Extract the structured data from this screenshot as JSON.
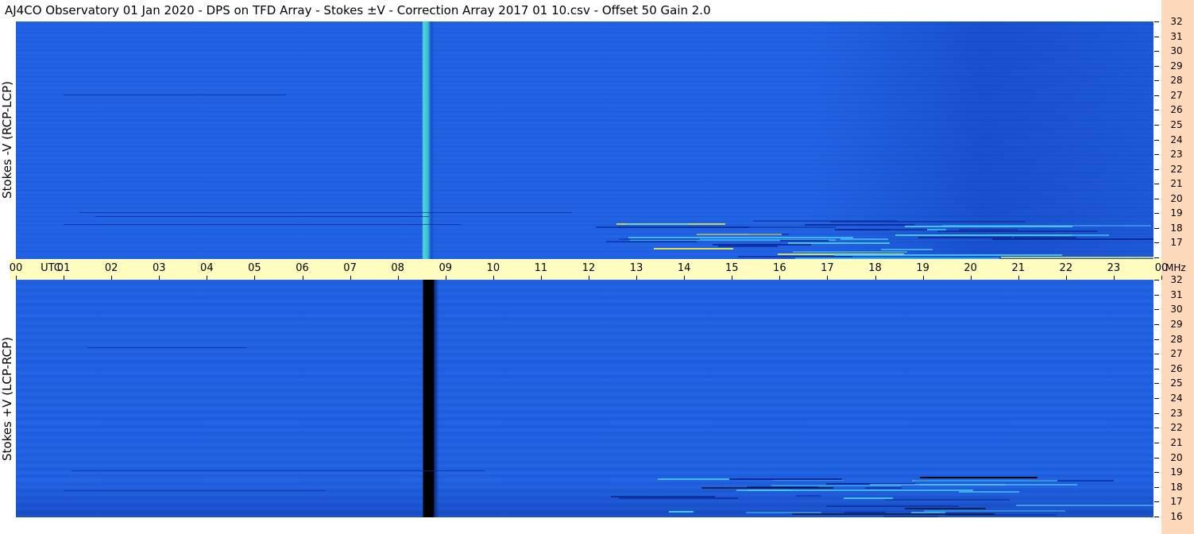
{
  "title": "AJ4CO Observatory  01 Jan 2020  -  DPS on TFD Array  -  Stokes ±V  -  Correction Array 2017 01 10.csv  -  Offset 50  Gain 2.0",
  "chart_data": {
    "type": "heatmap",
    "x_axis": {
      "unit_label": "UTC",
      "ticks": [
        "00",
        "01",
        "02",
        "03",
        "04",
        "05",
        "06",
        "07",
        "08",
        "09",
        "10",
        "11",
        "12",
        "13",
        "14",
        "15",
        "16",
        "17",
        "18",
        "19",
        "20",
        "21",
        "22",
        "23",
        "00"
      ],
      "range": [
        0,
        24
      ]
    },
    "y_axis": {
      "unit_label": "MHz",
      "ticks": [
        "16",
        "17",
        "18",
        "19",
        "20",
        "21",
        "22",
        "23",
        "24",
        "25",
        "26",
        "27",
        "28",
        "29",
        "30",
        "31",
        "32"
      ],
      "range": [
        16,
        32
      ]
    },
    "panels": [
      {
        "label": "Stokes -V (RCP-LCP)",
        "position": "top",
        "vertical_stripe_utc": 8.6,
        "stripe_color": "#52d8d0"
      },
      {
        "label": "Stokes +V (LCP-RCP)",
        "position": "bottom",
        "vertical_stripe_utc": 8.6,
        "stripe_color": "#000000"
      }
    ],
    "colors": {
      "background": "#1f62e8",
      "dark": "#0b2a9a",
      "bright": "#48c8f0",
      "hot": "#e8e840"
    }
  }
}
